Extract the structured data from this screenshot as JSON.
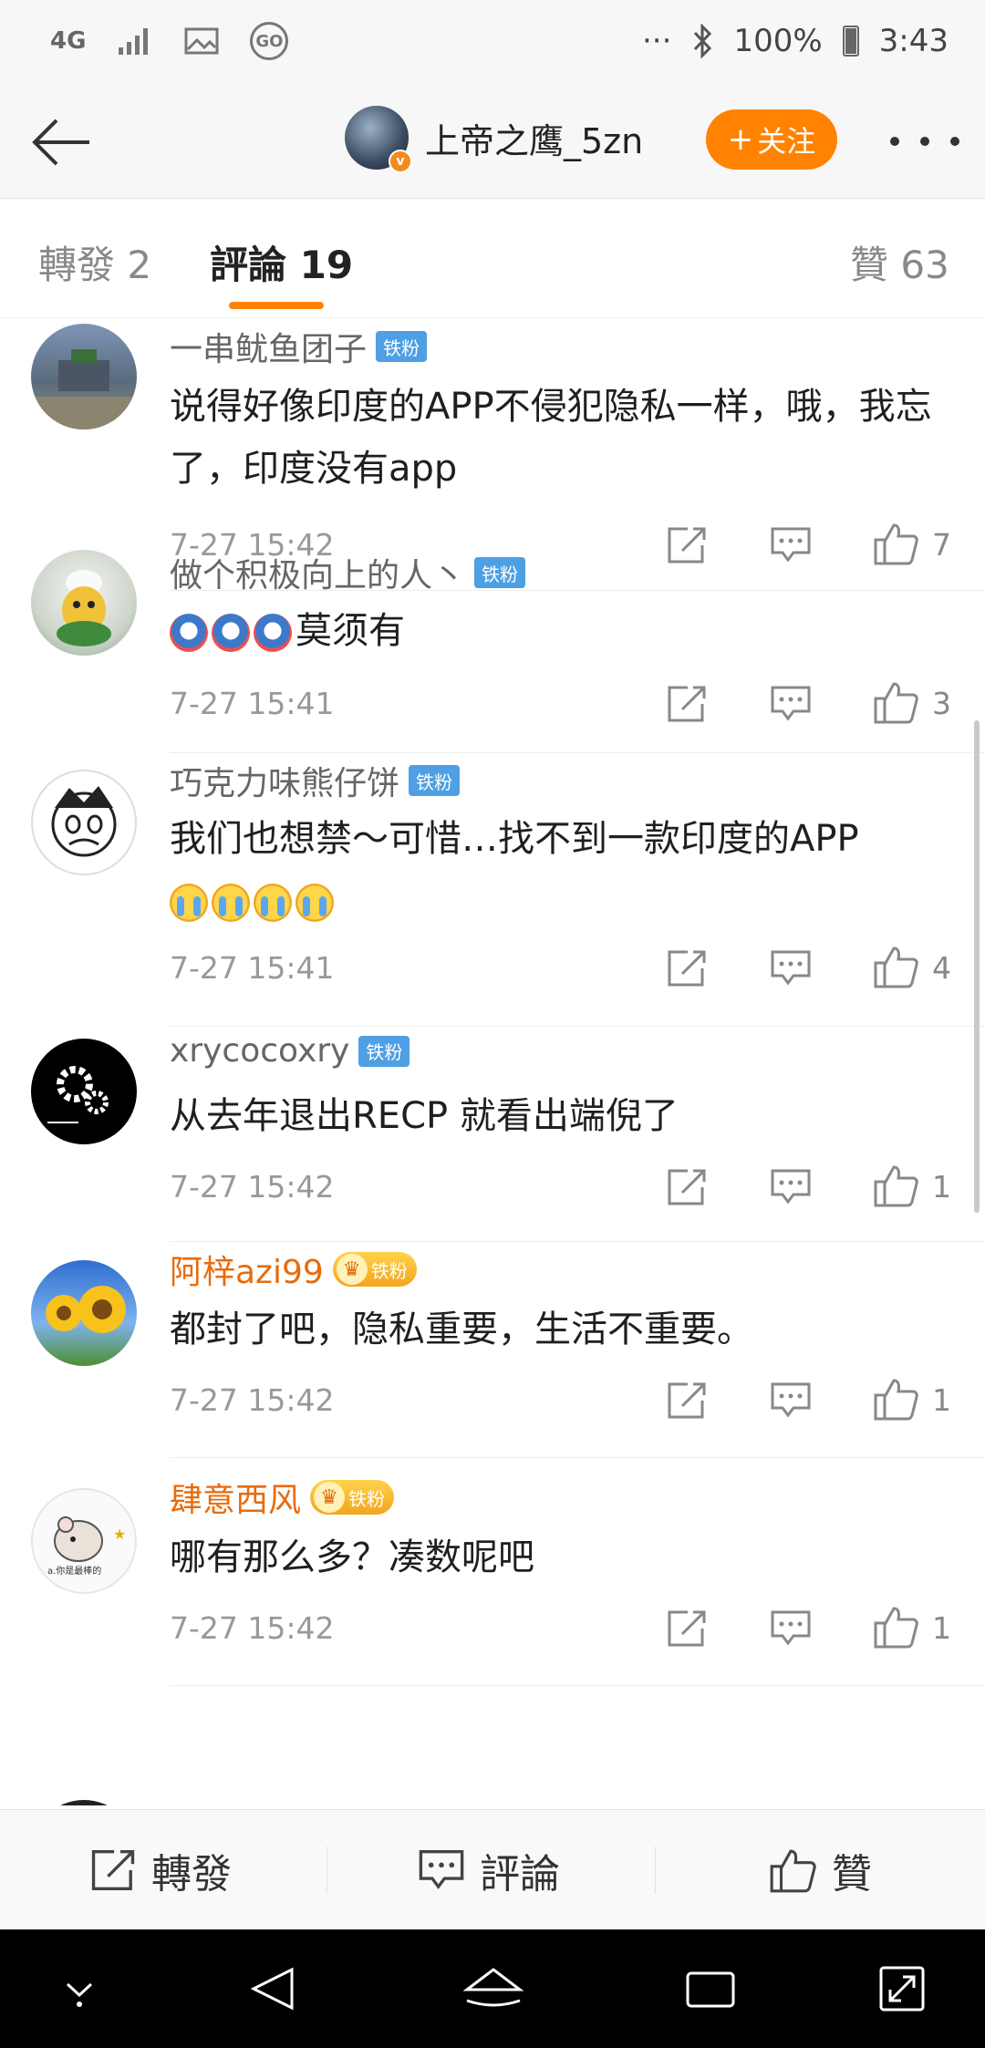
{
  "status_bar": {
    "network": "4G",
    "dots": "···",
    "battery": "100%",
    "time": "3:43"
  },
  "header": {
    "title": "上帝之鹰_5zn",
    "follow_label": "关注"
  },
  "tabs": {
    "repost": "轉發 2",
    "comments": "評論 19",
    "likes": "贊 63"
  },
  "comments": [
    {
      "username": "一串鱿鱼团子",
      "badge": "铁粉",
      "text": "说得好像印度的APP不侵犯隐私一样，哦，我忘了，印度没有app",
      "time": "7-27 15:42",
      "likes": "7"
    },
    {
      "username": "做个积极向上的人丶",
      "badge": "铁粉",
      "text": "莫须有",
      "time": "7-27 15:41",
      "likes": "3"
    },
    {
      "username": "巧克力味熊仔饼",
      "badge": "铁粉",
      "text": "我们也想禁～可惜…找不到一款印度的APP",
      "time": "7-27 15:41",
      "likes": "4"
    },
    {
      "username": "xrycocoxry",
      "badge": "铁粉",
      "text": "从去年退出RECP  就看出端倪了",
      "time": "7-27 15:42",
      "likes": "1"
    },
    {
      "username": "阿梓azi99",
      "badge": "铁粉",
      "text": "都封了吧，隐私重要，生活不重要。",
      "time": "7-27 15:42",
      "likes": "1"
    },
    {
      "username": "肆意西风",
      "badge": "铁粉",
      "text": "哪有那么多？凑数呢吧",
      "time": "7-27 15:42",
      "likes": "1"
    }
  ],
  "bottom_bar": {
    "repost": "轉發",
    "comment": "評論",
    "like": "贊"
  },
  "colors": {
    "accent": "#ff8200",
    "fan_badge": "#4e9fe3",
    "vip_name": "#e86b0a"
  }
}
